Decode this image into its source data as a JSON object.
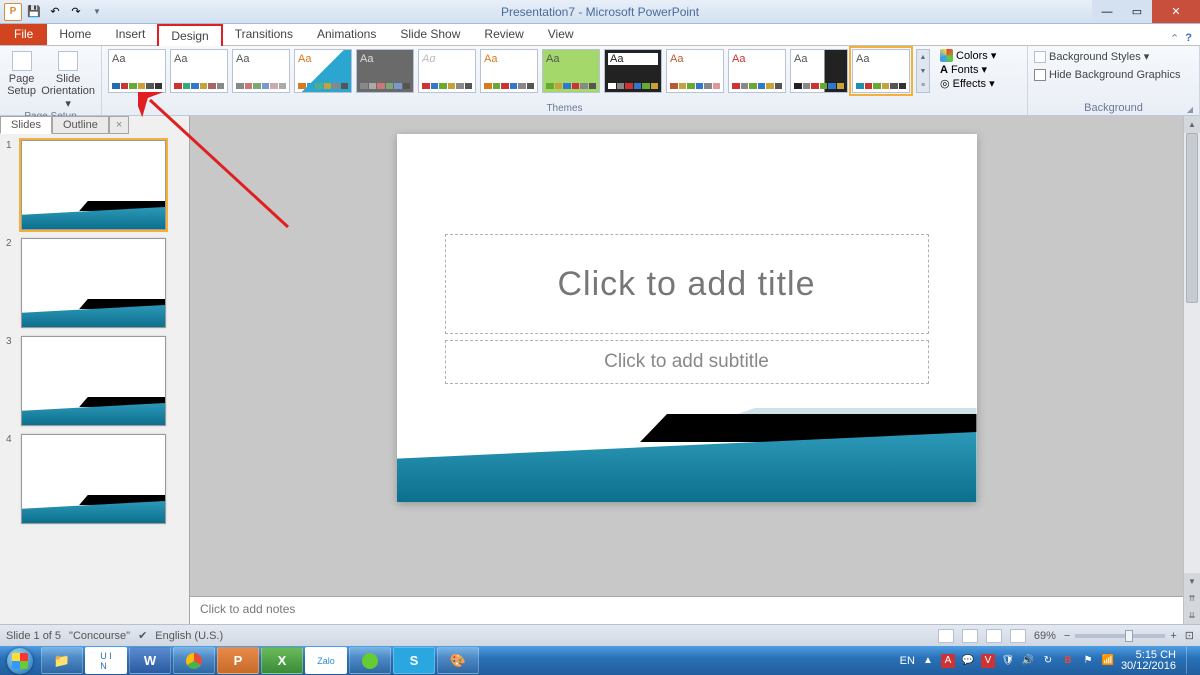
{
  "title": "Presentation7 - Microsoft PowerPoint",
  "tabs": {
    "file": "File",
    "home": "Home",
    "insert": "Insert",
    "design": "Design",
    "transitions": "Transitions",
    "animations": "Animations",
    "slideshow": "Slide Show",
    "review": "Review",
    "view": "View"
  },
  "ribbon": {
    "page_setup_group": "Page Setup",
    "page_setup": "Page\nSetup",
    "slide_orientation": "Slide\nOrientation ▾",
    "themes_group": "Themes",
    "colors": "Colors ▾",
    "fonts": "Fonts ▾",
    "effects": "Effects ▾",
    "background_group": "Background",
    "background_styles": "Background Styles ▾",
    "hide_background": "Hide Background Graphics"
  },
  "side": {
    "slides_tab": "Slides",
    "outline_tab": "Outline",
    "n1": "1",
    "n2": "2",
    "n3": "3",
    "n4": "4"
  },
  "placeholders": {
    "title": "Click to add title",
    "subtitle": "Click to add subtitle",
    "notes": "Click to add notes"
  },
  "status": {
    "slide": "Slide 1 of 5",
    "theme": "\"Concourse\"",
    "lang": "English (U.S.)",
    "zoom": "69%"
  },
  "tray": {
    "lang": "EN",
    "time": "5:15 CH",
    "date": "30/12/2016"
  }
}
